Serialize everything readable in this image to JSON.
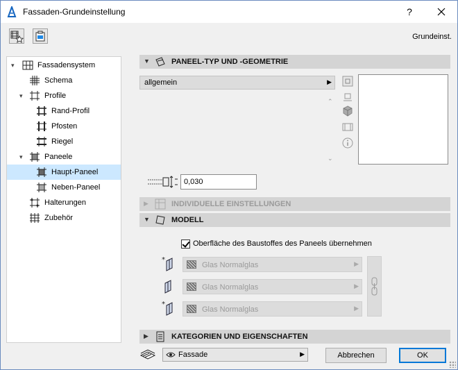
{
  "window": {
    "title": "Fassaden-Grundeinstellung",
    "help_label": "?",
    "close_label": "✕"
  },
  "header": {
    "preset_label": "Grundeinst."
  },
  "tree": {
    "items": [
      {
        "label": "Fassadensystem",
        "icon": "grid-icon"
      },
      {
        "label": "Schema",
        "icon": "hash-icon"
      },
      {
        "label": "Profile",
        "icon": "frame-icon"
      },
      {
        "label": "Rand-Profil",
        "icon": "frame-icon"
      },
      {
        "label": "Pfosten",
        "icon": "frame-icon"
      },
      {
        "label": "Riegel",
        "icon": "frame-icon"
      },
      {
        "label": "Paneele",
        "icon": "panel-icon"
      },
      {
        "label": "Haupt-Paneel",
        "icon": "panel-icon"
      },
      {
        "label": "Neben-Paneel",
        "icon": "panel-icon"
      },
      {
        "label": "Halterungen",
        "icon": "bracket-icon"
      },
      {
        "label": "Zubehör",
        "icon": "accessory-icon"
      }
    ],
    "selected": "Haupt-Paneel"
  },
  "sections": {
    "panel_type": {
      "title": "PANEEL-TYP UND -GEOMETRIE"
    },
    "individual": {
      "title": "INDIVIDUELLE EINSTELLUNGEN"
    },
    "model": {
      "title": "MODELL"
    },
    "categories": {
      "title": "KATEGORIEN UND EIGENSCHAFTEN"
    }
  },
  "panel_type": {
    "selected_type": "allgemein",
    "thickness": "0,030"
  },
  "model": {
    "override_checkbox_label": "Oberfläche des Baustoffes des Paneels übernehmen",
    "override_checked": true,
    "materials": [
      "Glas Normalglas",
      "Glas Normalglas",
      "Glas Normalglas"
    ]
  },
  "footer": {
    "layer_value": "Fassade",
    "cancel_label": "Abbrechen",
    "ok_label": "OK"
  },
  "colors": {
    "selection": "#cce8ff",
    "section_header": "#d4d4d4",
    "default_button_border": "#0078d7"
  }
}
